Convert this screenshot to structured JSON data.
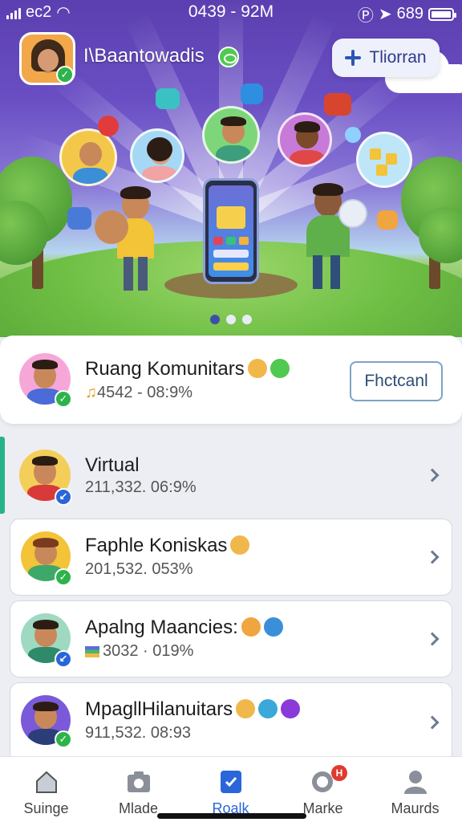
{
  "status_bar": {
    "carrier": "ec2",
    "time": "0439 - 92M",
    "battery_text": "689"
  },
  "header": {
    "profile_name": "I\\Baantowadis",
    "action_button_label": "Tliorran"
  },
  "carousel": {
    "page_count": 3,
    "active_page": 1
  },
  "featured": {
    "title": "Ruang Komunitars",
    "meta": "4542 - 08:9%",
    "follow_label": "Fhctcanl"
  },
  "list": [
    {
      "title": "Virtual",
      "meta": "211,332. 06:9%"
    },
    {
      "title": "Faphle Koniskas",
      "meta": "201,532. 053%"
    },
    {
      "title": "Apalng Maancies:",
      "meta": "3032 · 019%"
    },
    {
      "title": "MpagllHilanuitars",
      "meta": "911,532. 08:93"
    }
  ],
  "tabs": [
    {
      "label": "Suinge",
      "icon": "home-icon"
    },
    {
      "label": "Mlade",
      "icon": "camera-icon"
    },
    {
      "label": "Roalk",
      "icon": "bookmark-icon",
      "active": true
    },
    {
      "label": "Marke",
      "icon": "chat-icon",
      "badge": "H"
    },
    {
      "label": "Maurds",
      "icon": "person-icon"
    }
  ],
  "colors": {
    "hero_purple": "#5b3fb0",
    "accent_blue": "#2a66d9",
    "verified_green": "#2db34a",
    "accent_bar_teal": "#26b38a"
  }
}
